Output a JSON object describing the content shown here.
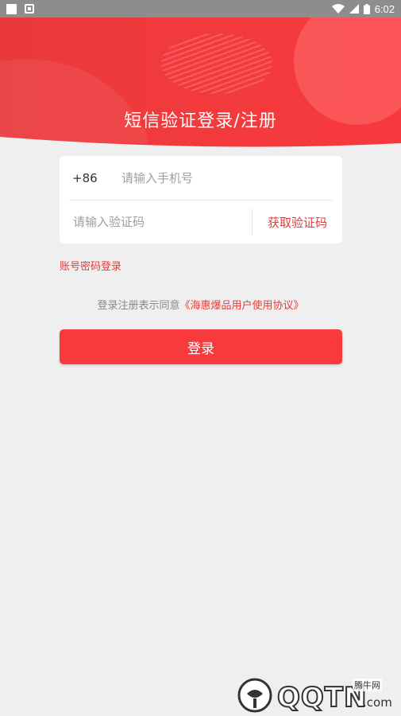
{
  "header": {
    "title": "短信验证登录/注册"
  },
  "form": {
    "country_code": "+86",
    "phone_placeholder": "请输入手机号",
    "phone_value": "",
    "code_placeholder": "请输入验证码",
    "code_value": "",
    "get_code_label": "获取验证码"
  },
  "links": {
    "password_login": "账号密码登录"
  },
  "agreement": {
    "prefix": "登录注册表示同意",
    "link": "《海惠爆品用户使用协议》"
  },
  "login_button_label": "登录",
  "status_bar": {
    "time": "6:02"
  },
  "watermark": {
    "logo_text": "QQTN",
    "domain": ".com",
    "sub_label": "腾牛网"
  },
  "colors": {
    "accent": "#f83a3c",
    "link_red": "#e9393b",
    "background": "#efefef"
  }
}
